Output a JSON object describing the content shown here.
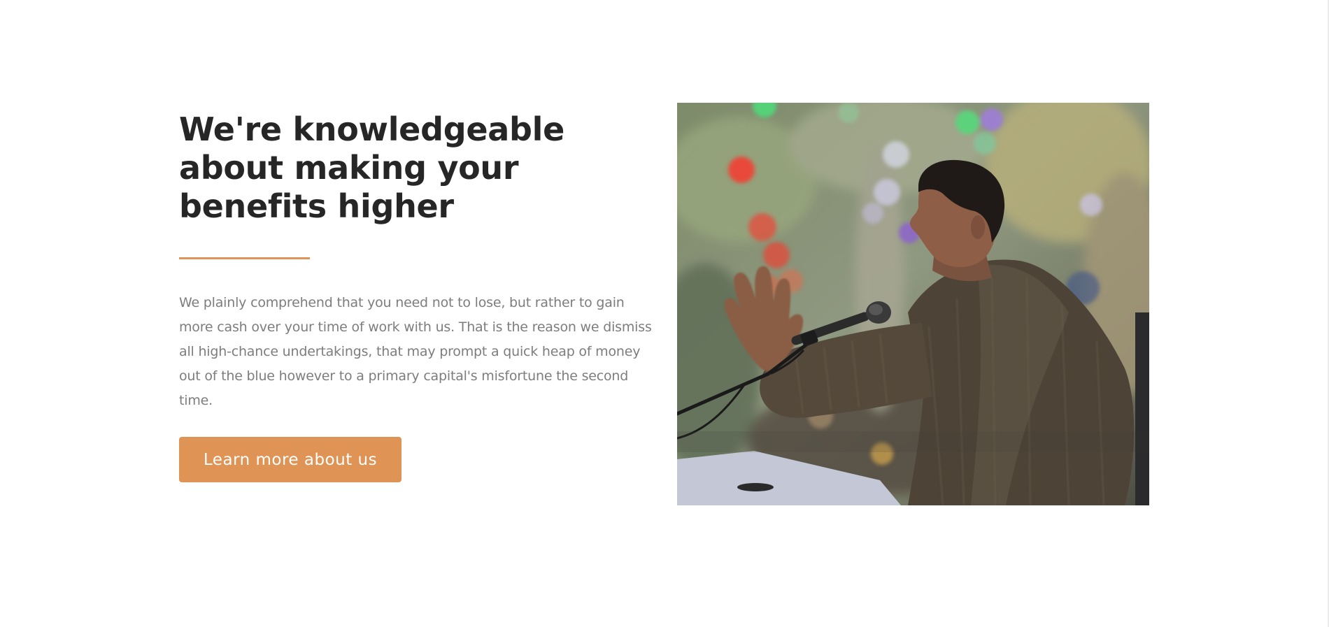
{
  "section": {
    "headline": "We're knowledgeable about making your benefits higher",
    "body": "We plainly comprehend that you need not to lose, but rather to gain more cash over your time of work with us. That is the reason we dismiss all high-chance undertakings, that may prompt a quick heap of money out of the blue however to a primary capital's misfortune the second time.",
    "cta_label": "Learn more about us"
  },
  "colors": {
    "accent": "#df9355",
    "headline": "#262626",
    "body_text": "#7d7d7d",
    "background": "#ffffff"
  },
  "photo": {
    "subject": "speaker-at-microphone-photo"
  }
}
